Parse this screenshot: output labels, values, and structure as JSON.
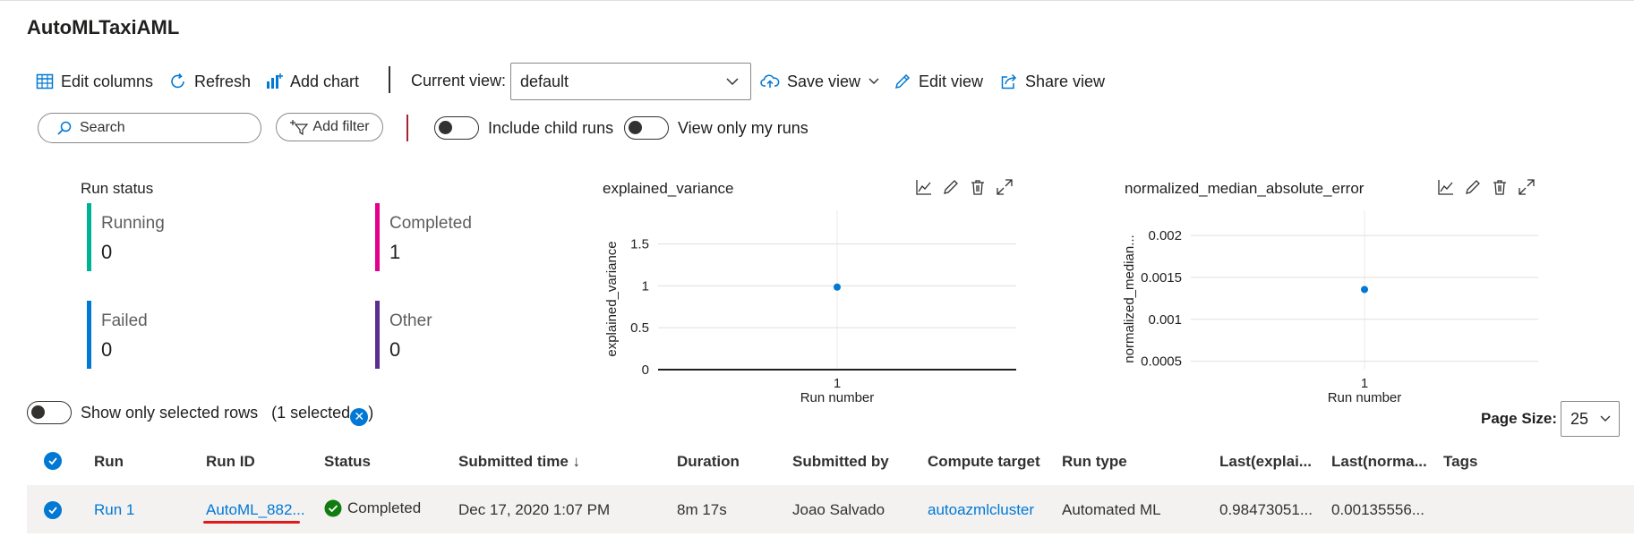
{
  "page": {
    "title": "AutoMLTaxiAML"
  },
  "toolbar": {
    "edit_columns": "Edit columns",
    "refresh": "Refresh",
    "add_chart": "Add chart",
    "current_view_label": "Current view:",
    "current_view_value": "default",
    "save_view": "Save view",
    "edit_view": "Edit view",
    "share_view": "Share view"
  },
  "filters": {
    "search_placeholder": "Search",
    "add_filter": "Add filter",
    "include_child_runs": "Include child runs",
    "view_only_my_runs": "View only my runs"
  },
  "run_status": {
    "title": "Run status",
    "tiles": [
      {
        "label": "Running",
        "count": "0",
        "color": "#00b294"
      },
      {
        "label": "Completed",
        "count": "1",
        "color": "#e3008c"
      },
      {
        "label": "Failed",
        "count": "0",
        "color": "#0078d4"
      },
      {
        "label": "Other",
        "count": "0",
        "color": "#5c2d91"
      }
    ]
  },
  "chart_data": [
    {
      "type": "scatter",
      "title": "explained_variance",
      "xlabel": "Run number",
      "ylabel": "explained_variance",
      "x": [
        1
      ],
      "y": [
        0.98473051
      ],
      "xticks": [
        "1"
      ],
      "yticks": [
        "0",
        "0.5",
        "1",
        "1.5"
      ],
      "ylim": [
        0,
        1.9
      ],
      "color": "#0078d4",
      "grid": true
    },
    {
      "type": "scatter",
      "title": "normalized_median_absolute_error",
      "xlabel": "Run number",
      "ylabel": "normalized_median...",
      "x": [
        1
      ],
      "y": [
        0.00135556
      ],
      "xticks": [
        "1"
      ],
      "yticks": [
        "0.0005",
        "0.001",
        "0.0015",
        "0.002"
      ],
      "ylim": [
        0.0004,
        0.0023
      ],
      "color": "#0078d4",
      "grid": true
    }
  ],
  "selection": {
    "show_only_selected": "Show only selected rows",
    "selected_prefix": "(1 selected",
    "selected_suffix": ")",
    "clear_icon": "✕"
  },
  "pagination": {
    "label": "Page Size:",
    "value": "25"
  },
  "table": {
    "headers": {
      "run": "Run",
      "run_id": "Run ID",
      "status": "Status",
      "submitted_time": "Submitted time ↓",
      "duration": "Duration",
      "submitted_by": "Submitted by",
      "compute_target": "Compute target",
      "run_type": "Run type",
      "last_explained": "Last(explai...",
      "last_normalized": "Last(norma...",
      "tags": "Tags"
    },
    "rows": [
      {
        "run": "Run 1",
        "run_id": "AutoML_882...",
        "status": "Completed",
        "submitted_time": "Dec 17, 2020 1:07 PM",
        "duration": "8m 17s",
        "submitted_by": "Joao Salvado",
        "compute_target": "autoazmlcluster",
        "run_type": "Automated ML",
        "last_explained": "0.98473051...",
        "last_normalized": "0.00135556...",
        "tags": ""
      }
    ]
  },
  "colors": {
    "accent": "#0078d4",
    "success": "#107c10",
    "annotation": "#e0191b"
  }
}
